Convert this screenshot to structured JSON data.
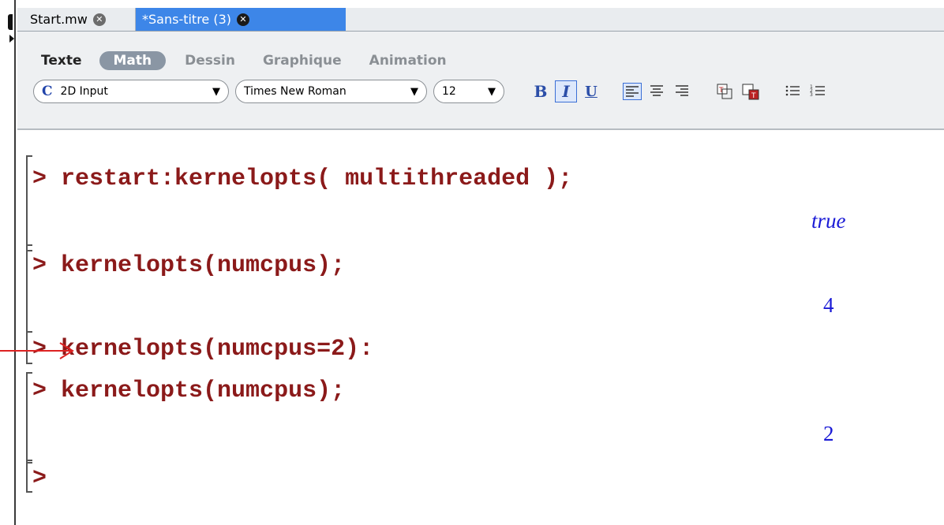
{
  "tabs": [
    {
      "label": "Start.mw",
      "close": "✕"
    },
    {
      "label": "*Sans-titre (3)",
      "close": "✕"
    }
  ],
  "modes": [
    "Texte",
    "Math",
    "Dessin",
    "Graphique",
    "Animation"
  ],
  "active_mode": "Math",
  "toolbar": {
    "input_mode_glyph": "C",
    "input_mode": "2D Input",
    "font": "Times New Roman",
    "size": "12",
    "bold": "B",
    "italic": "I",
    "underline": "U"
  },
  "worksheet": {
    "commands": [
      {
        "prompt": ">",
        "text": " restart:kernelopts( multithreaded );",
        "output": "true"
      },
      {
        "prompt": ">",
        "text": " kernelopts(numcpus);",
        "output": "4"
      },
      {
        "prompt": ">",
        "text": " kernelopts(numcpus=2):"
      },
      {
        "prompt": ">",
        "text": " kernelopts(numcpus);",
        "output": "2"
      },
      {
        "prompt": ">",
        "text": ""
      }
    ]
  },
  "colors": {
    "command": "#8b1a1a",
    "output": "#1a1ad6",
    "active_tab": "#3d86e8",
    "annotation_arrow": "#dd2222"
  }
}
